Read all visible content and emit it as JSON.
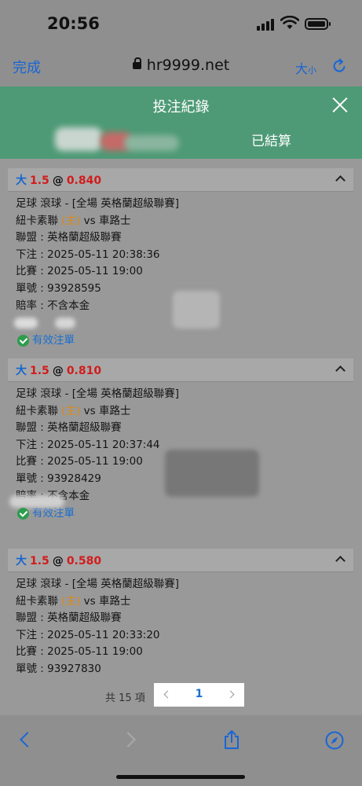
{
  "status_bar": {
    "time": "20:56"
  },
  "browser": {
    "done_label": "完成",
    "url": "hr9999.net",
    "text_size_label": "大",
    "text_size_small": "小"
  },
  "dialog": {
    "title": "投注紀錄",
    "tabs": {
      "settled": "已結算"
    }
  },
  "records": [
    {
      "bet_type": "大",
      "handicap": "1.5",
      "at": "@",
      "odds": "0.840",
      "market": "足球 滾球 - [全場 英格蘭超級聯賽]",
      "home": "紐卡素聯",
      "home_tag": "(主)",
      "vs": "vs",
      "away": "車路士",
      "league": "聯盟 : 英格蘭超級聯賽",
      "bet_time": "下注 : 2025-05-11 20:38:36",
      "match_time": "比賽 : 2025-05-11 19:00",
      "ticket": "單號 : 93928595",
      "odds_type": "賠率 : 不含本金",
      "status": "有效注單"
    },
    {
      "bet_type": "大",
      "handicap": "1.5",
      "at": "@",
      "odds": "0.810",
      "market": "足球 滾球 - [全場 英格蘭超級聯賽]",
      "home": "紐卡素聯",
      "home_tag": "(主)",
      "vs": "vs",
      "away": "車路士",
      "league": "聯盟 : 英格蘭超級聯賽",
      "bet_time": "下注 : 2025-05-11 20:37:44",
      "match_time": "比賽 : 2025-05-11 19:00",
      "ticket": "單號 : 93928429",
      "odds_type": "賠率 : 不含本金",
      "status": "有效注單"
    },
    {
      "bet_type": "大",
      "handicap": "1.5",
      "at": "@",
      "odds": "0.580",
      "market": "足球 滾球 - [全場 英格蘭超級聯賽]",
      "home": "紐卡素聯",
      "home_tag": "(主)",
      "vs": "vs",
      "away": "車路士",
      "league": "聯盟 : 英格蘭超級聯賽",
      "bet_time": "下注 : 2025-05-11 20:33:20",
      "match_time": "比賽 : 2025-05-11 19:00",
      "ticket": "單號 : 93927830"
    }
  ],
  "pagination": {
    "total": "共 15 項",
    "current_page": "1"
  },
  "colors": {
    "header_green": "#4e9a76",
    "link_blue": "#1766d6",
    "odds_red": "#d21c1c",
    "home_orange": "#d98a18",
    "valid_green": "#2e9b4d"
  },
  "icons": [
    "lock-icon",
    "reload-icon",
    "close-icon",
    "chevron-up-icon",
    "check-icon",
    "back-icon",
    "forward-icon",
    "share-icon",
    "compass-icon"
  ]
}
